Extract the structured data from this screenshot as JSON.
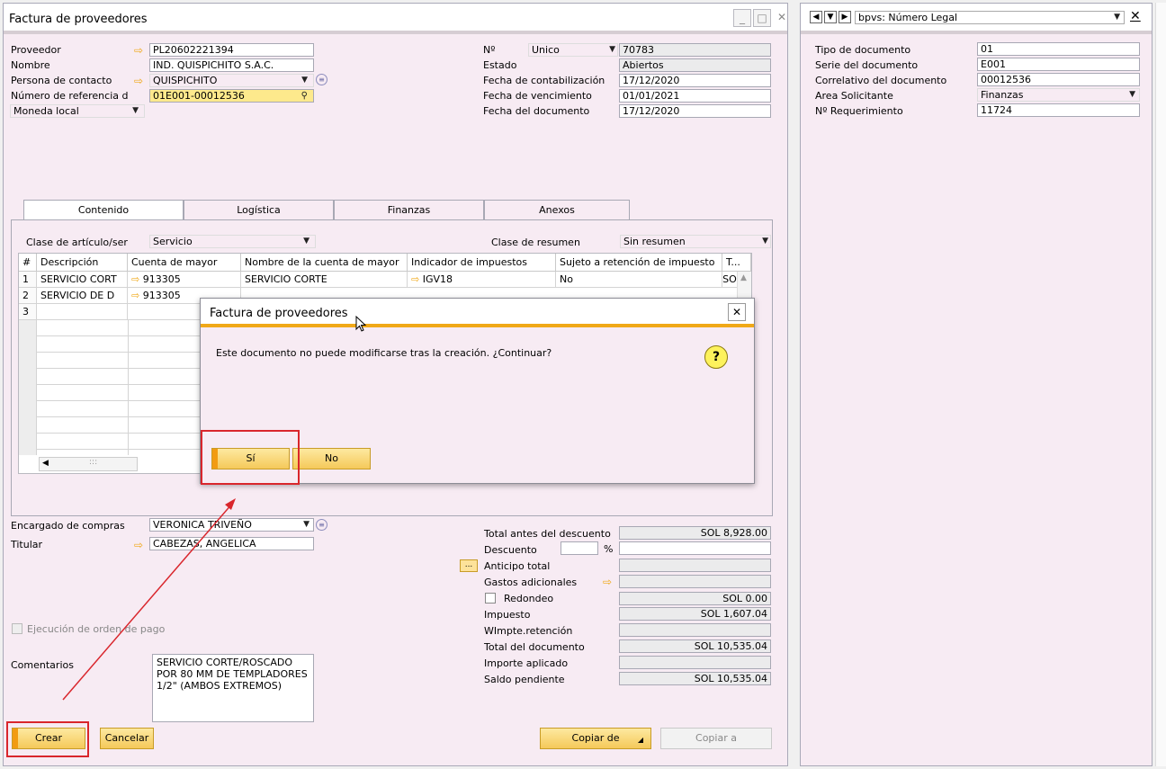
{
  "main": {
    "title": "Factura de proveedores",
    "left_fields": [
      {
        "label": "Proveedor",
        "value": "PL20602221394"
      },
      {
        "label": "Nombre",
        "value": "IND. QUISPICHITO S.A.C."
      },
      {
        "label": "Persona de contacto",
        "value": "QUISPICHITO"
      },
      {
        "label": "Número de referencia d",
        "value": "01E001-00012536"
      }
    ],
    "currency": "Moneda local",
    "right_fields": {
      "num_label": "Nº",
      "num_series": "Unico",
      "num_value": "70783",
      "estado_label": "Estado",
      "estado_value": "Abiertos",
      "fc_label": "Fecha de contabilización",
      "fc_value": "17/12/2020",
      "fv_label": "Fecha de vencimiento",
      "fv_value": "01/01/2021",
      "fd_label": "Fecha del documento",
      "fd_value": "17/12/2020"
    },
    "tabs": [
      "Contenido",
      "Logística",
      "Finanzas",
      "Anexos"
    ],
    "item_class_label": "Clase de artículo/ser",
    "item_class_value": "Servicio",
    "summary_label": "Clase de resumen",
    "summary_value": "Sin resumen",
    "grid": {
      "headers": [
        "#",
        "Descripción",
        "Cuenta de mayor",
        "Nombre de la cuenta de mayor",
        "Indicador de impuestos",
        "Sujeto a retención de impuesto",
        "T..."
      ],
      "rows": [
        [
          "1",
          "SERVICIO CORT",
          "913305",
          "SERVICIO CORTE",
          "IGV18",
          "No",
          "SOI"
        ],
        [
          "2",
          "SERVICIO DE D",
          "913305",
          "",
          "",
          "",
          ""
        ],
        [
          "3",
          "",
          "",
          "",
          "",
          "",
          ""
        ]
      ],
      "scroll_glyph": ":::"
    },
    "buyer_label": "Encargado de compras",
    "buyer_value": "VERONICA TRIVEÑO",
    "owner_label": "Titular",
    "owner_value": "CABEZAS, ANGELICA",
    "payment_order_label": "Ejecución de orden de pago",
    "comments_label": "Comentarios",
    "comments_value": "SERVICIO CORTE/ROSCADO POR 80 MM DE TEMPLADORES 1/2\" (AMBOS EXTREMOS)",
    "totals": {
      "before_discount_label": "Total antes del descuento",
      "before_discount_value": "SOL 8,928.00",
      "discount_label": "Descuento",
      "percent": "%",
      "advance_label": "Anticipo total",
      "ellipsis": "...",
      "extra_label": "Gastos adicionales",
      "rounding_label": "Redondeo",
      "rounding_value": "SOL 0.00",
      "tax_label": "Impuesto",
      "tax_value": "SOL 1,607.04",
      "withholding_label": "WImpte.retención",
      "total_label": "Total del documento",
      "total_value": "SOL 10,535.04",
      "applied_label": "Importe aplicado",
      "pending_label": "Saldo pendiente",
      "pending_value": "SOL 10,535.04"
    },
    "buttons": {
      "create": "Crear",
      "cancel": "Cancelar",
      "copy_from": "Copiar de",
      "copy_to": "Copiar a"
    }
  },
  "side": {
    "title": "bpvs: Número Legal",
    "fields": [
      {
        "label": "Tipo de documento",
        "value": "01"
      },
      {
        "label": "Serie del documento",
        "value": "E001"
      },
      {
        "label": "Correlativo del documento",
        "value": "00012536"
      },
      {
        "label": "Area Solicitante",
        "value": "Finanzas"
      },
      {
        "label": "Nº Requerimiento",
        "value": "11724"
      }
    ]
  },
  "dialog": {
    "title": "Factura de proveedores",
    "message": "Este documento no puede modificarse tras la creación. ¿Continuar?",
    "yes": "Sí",
    "no": "No",
    "question_glyph": "?"
  },
  "colors": {
    "accent": "#f0a818",
    "annotation_red": "#d9262c",
    "form_bg": "#f7ebf3"
  }
}
